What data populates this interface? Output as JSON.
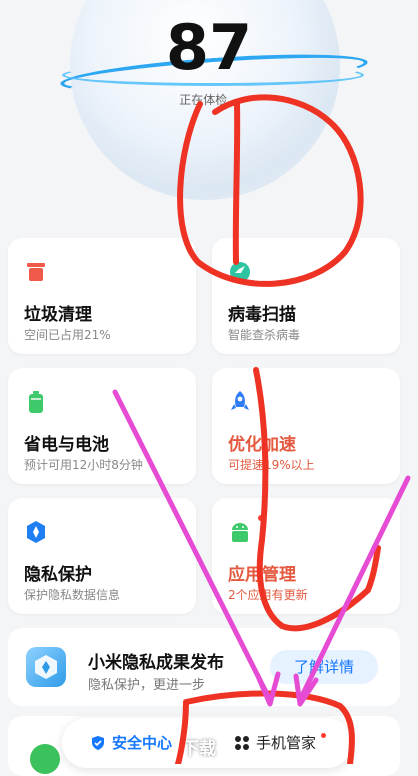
{
  "header": {
    "score": "87",
    "status": "正在体检..."
  },
  "cards": [
    {
      "title": "垃圾清理",
      "sub": "空间已占用21%",
      "icon": "trash-icon",
      "color": "#ef5a4a"
    },
    {
      "title": "病毒扫描",
      "sub": "智能查杀病毒",
      "icon": "shield-check-icon",
      "color": "#2ec4a2"
    },
    {
      "title": "省电与电池",
      "sub": "预计可用12小时8分钟",
      "icon": "battery-icon",
      "color": "#3ec96a"
    },
    {
      "title": "优化加速",
      "sub": "可提速19%以上",
      "icon": "rocket-icon",
      "color": "#2f7cf6"
    },
    {
      "title": "隐私保护",
      "sub": "保护隐私数据信息",
      "icon": "privacy-icon",
      "color": "#1f7ff2"
    },
    {
      "title": "应用管理",
      "sub": "2个应用有更新",
      "icon": "android-icon",
      "color": "#3ec96a"
    }
  ],
  "promo": {
    "title": "小米隐私成果发布",
    "subtitle": "隐私保护，更进一步",
    "button": "了解详情"
  },
  "tabs": {
    "left": "安全中心",
    "right": "手机管家"
  },
  "watermark": "下载"
}
